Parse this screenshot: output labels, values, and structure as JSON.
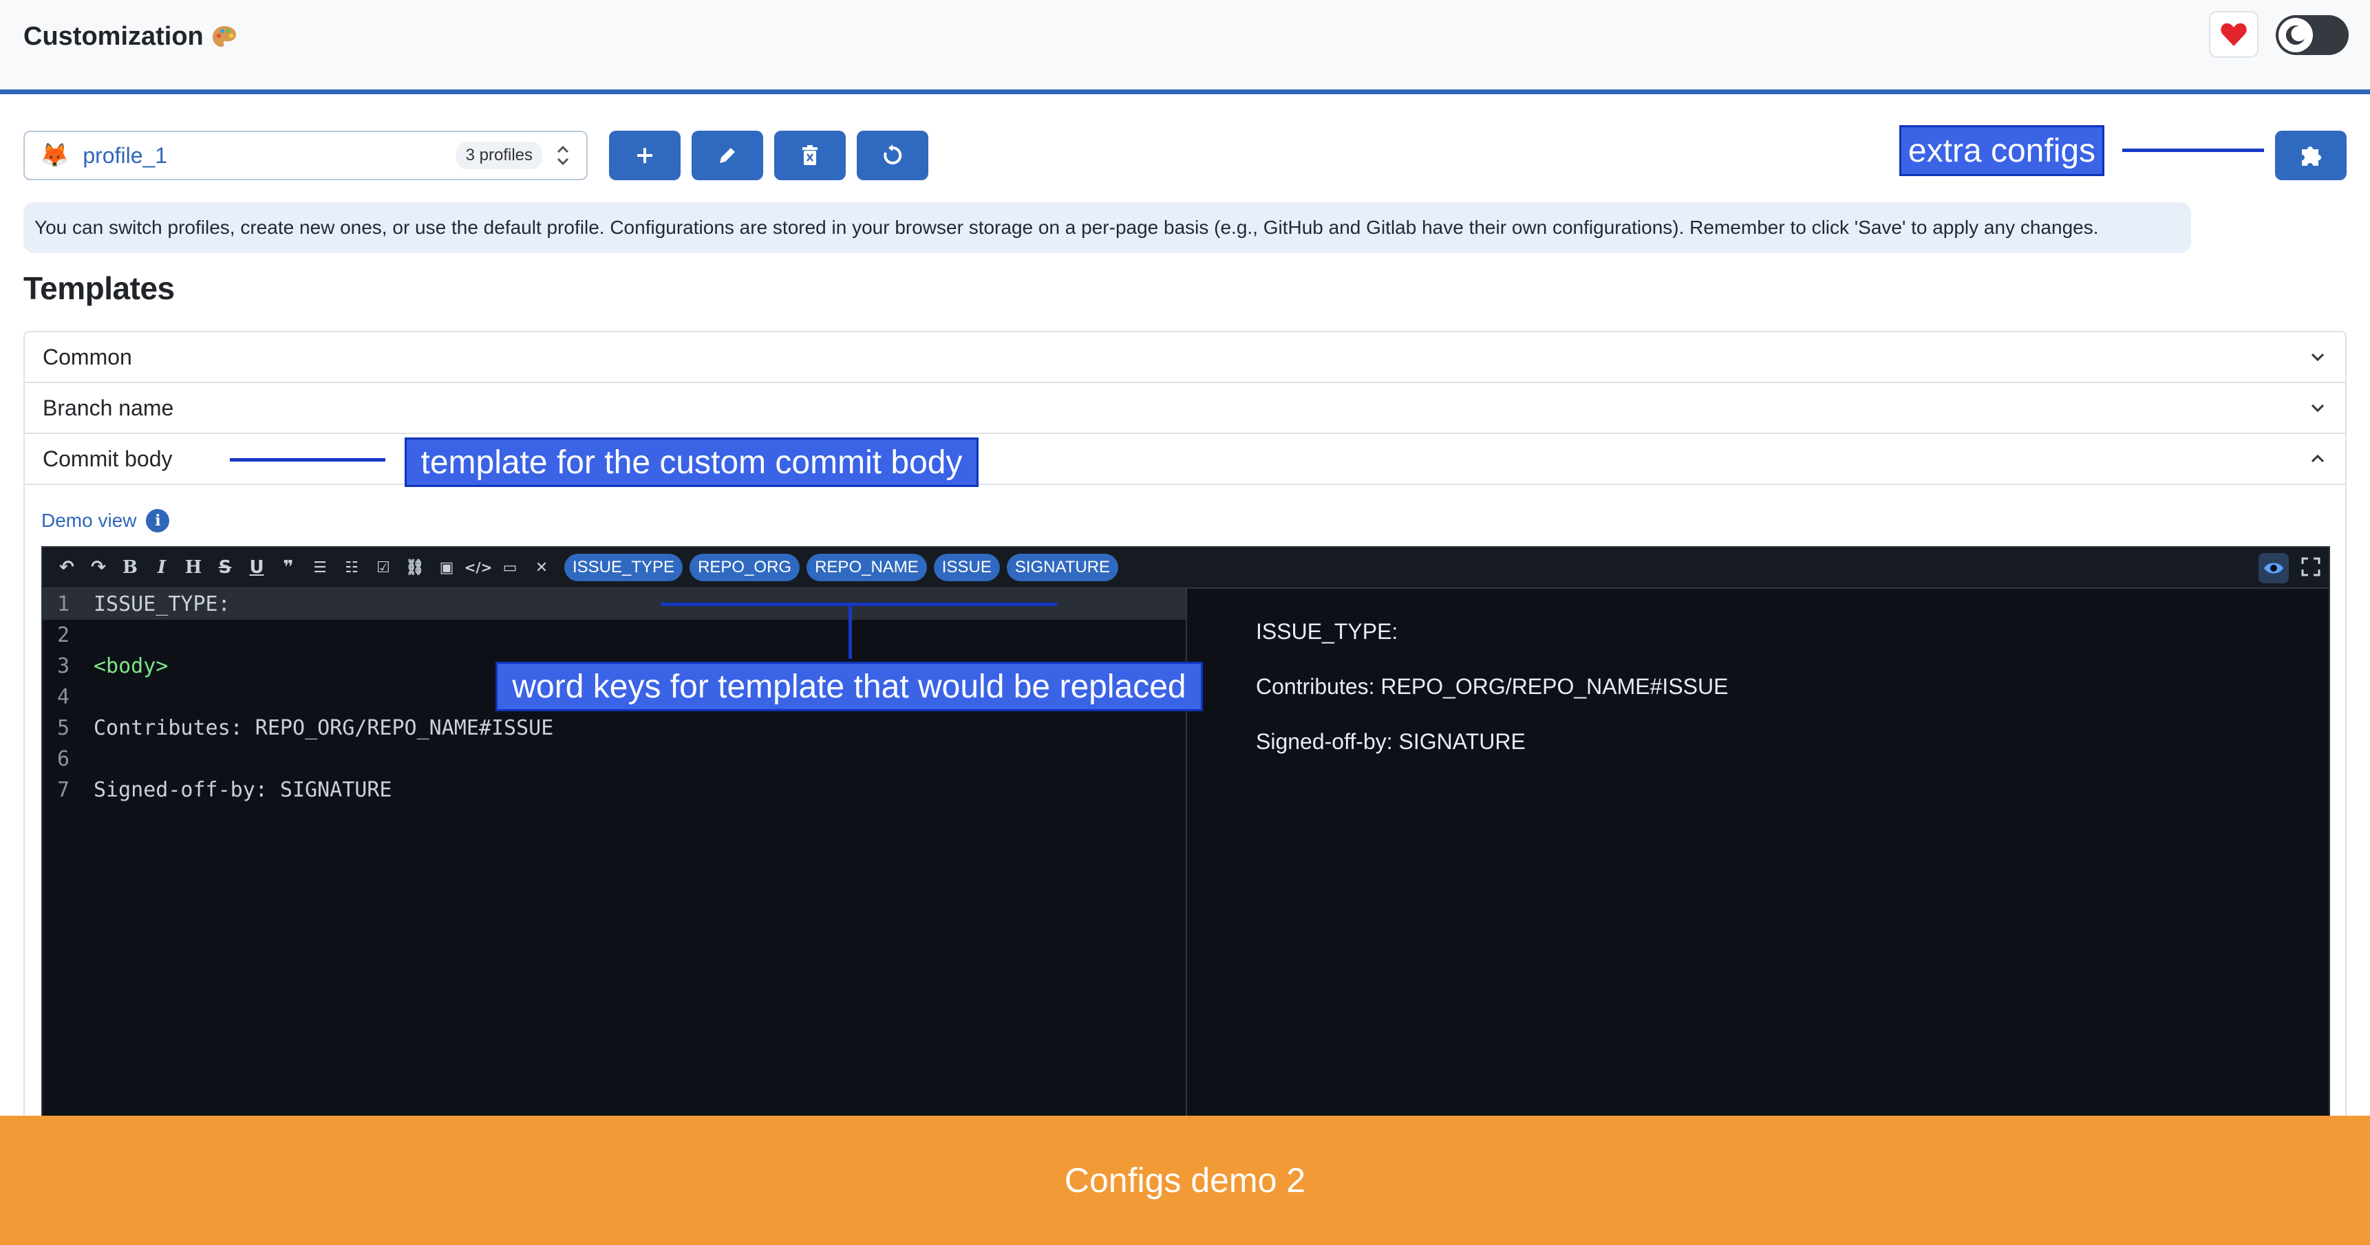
{
  "header": {
    "title": "Customization"
  },
  "profile": {
    "name": "profile_1",
    "count": "3 profiles"
  },
  "info_text": "You can switch profiles, create new ones, or use the default profile. Configurations are stored in your browser storage on a per-page basis (e.g., GitHub and Gitlab have their own configurations). Remember to click 'Save' to apply any changes.",
  "templates": {
    "title": "Templates",
    "sections": [
      {
        "label": "Common"
      },
      {
        "label": "Branch name"
      },
      {
        "label": "Commit body"
      }
    ]
  },
  "demo": {
    "label": "Demo view"
  },
  "toolbar": {
    "chips": [
      "ISSUE_TYPE",
      "REPO_ORG",
      "REPO_NAME",
      "ISSUE",
      "SIGNATURE"
    ]
  },
  "code": {
    "lines": [
      {
        "num": "1",
        "text": "ISSUE_TYPE:"
      },
      {
        "num": "2",
        "text": ""
      },
      {
        "num": "3",
        "text": "<body>"
      },
      {
        "num": "4",
        "text": ""
      },
      {
        "num": "5",
        "text": "Contributes: REPO_ORG/REPO_NAME#ISSUE"
      },
      {
        "num": "6",
        "text": ""
      },
      {
        "num": "7",
        "text": "Signed-off-by: SIGNATURE"
      }
    ]
  },
  "preview": {
    "lines": [
      "ISSUE_TYPE:",
      "Contributes: REPO_ORG/REPO_NAME#ISSUE",
      "Signed-off-by: SIGNATURE"
    ]
  },
  "annotations": {
    "extra_configs": "extra configs",
    "commit_body": "template for the custom commit body",
    "word_keys": "word keys for template that would be replaced"
  },
  "footer": {
    "caption": "Configs demo 2"
  },
  "colors": {
    "accent": "#3069c0",
    "header_border": "#2f66b8",
    "footer": "#f29a36",
    "annotation": "#3a63e6",
    "editor_bg": "#0d1117"
  },
  "icons": [
    "palette-icon",
    "heart-icon",
    "moon-icon",
    "fox-icon",
    "chevron-updown-icon",
    "plus-icon",
    "pencil-icon",
    "trash-icon",
    "refresh-icon",
    "puzzle-icon",
    "chevron-down-icon",
    "chevron-up-icon",
    "info-icon",
    "eye-icon",
    "fullscreen-icon"
  ]
}
